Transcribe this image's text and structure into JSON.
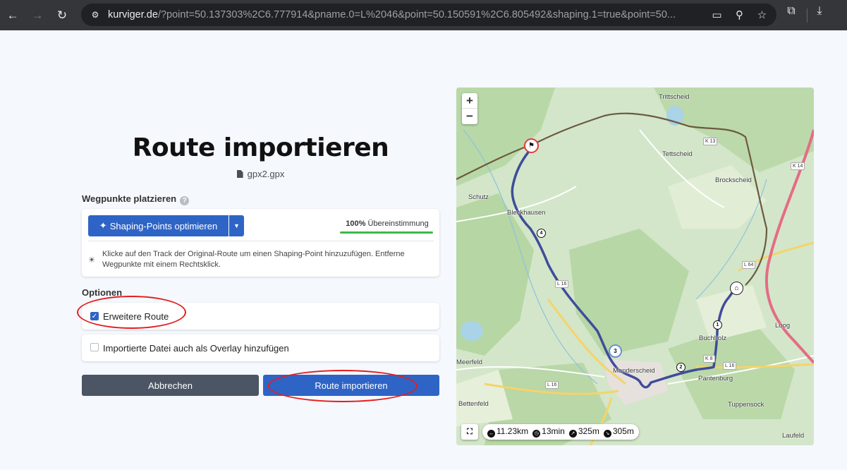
{
  "browser": {
    "url_host": "kurviger.de",
    "url_rest": "/?point=50.137303%2C6.777914&pname.0=L%2046&point=50.150591%2C6.805492&shaping.1=true&point=50...",
    "back_icon": "←",
    "forward_icon": "→",
    "reload_icon": "↻",
    "tune_icon": "⚙",
    "cast_icon": "▭",
    "zoom_icon": "⚲",
    "bookmark_icon": "☆",
    "extensions_icon": "⧉",
    "download_icon": "⤓",
    "menu_icon": "⋮"
  },
  "dialog": {
    "title": "Route importieren",
    "filename": "gpx2.gpx",
    "waypoints_label": "Wegpunkte platzieren",
    "help_icon": "?",
    "optimize_button": "Shaping-Points optimieren",
    "optimize_icon": "✦",
    "caret_icon": "▼",
    "match_percent": "100%",
    "match_label": "Übereinstimmung",
    "match_value": 1.0,
    "hint_icon": "☀",
    "hint_text": "Klicke auf den Track der Original-Route um einen Shaping-Point hinzuzufügen. Entferne Wegpunkte mit einem Rechtsklick.",
    "options_label": "Optionen",
    "option_extended": "Erweitere Route",
    "option_extended_checked": true,
    "option_overlay": "Importierte Datei auch als Overlay hinzufügen",
    "option_overlay_checked": false,
    "cancel_button": "Abbrechen",
    "import_button": "Route importieren"
  },
  "map": {
    "zoom_in": "+",
    "zoom_out": "−",
    "fullscreen_icon": "⛶",
    "places": [
      "Trittscheid",
      "Tettscheid",
      "Brockscheid",
      "Schutz",
      "Bleckhausen",
      "Buchholz",
      "Meerfeld",
      "Manderscheid",
      "Pantenburg",
      "Bettenfeld",
      "Laufeld",
      "Tuppensock",
      "Loog"
    ],
    "road_tags": [
      "K 13",
      "K 14",
      "L 16",
      "L 16",
      "L 16",
      "K 8",
      "L 64"
    ],
    "waypoints": [
      "1",
      "2",
      "3",
      "4"
    ],
    "stats": {
      "distance": "11.23km",
      "duration": "13min",
      "ascent": "325m",
      "descent": "305m"
    }
  },
  "colors": {
    "primary": "#2f64c7",
    "cancel": "#4b5563",
    "route": "#3f4c9a",
    "annotation": "#e41d1d",
    "match_bar": "#3fb84a"
  }
}
